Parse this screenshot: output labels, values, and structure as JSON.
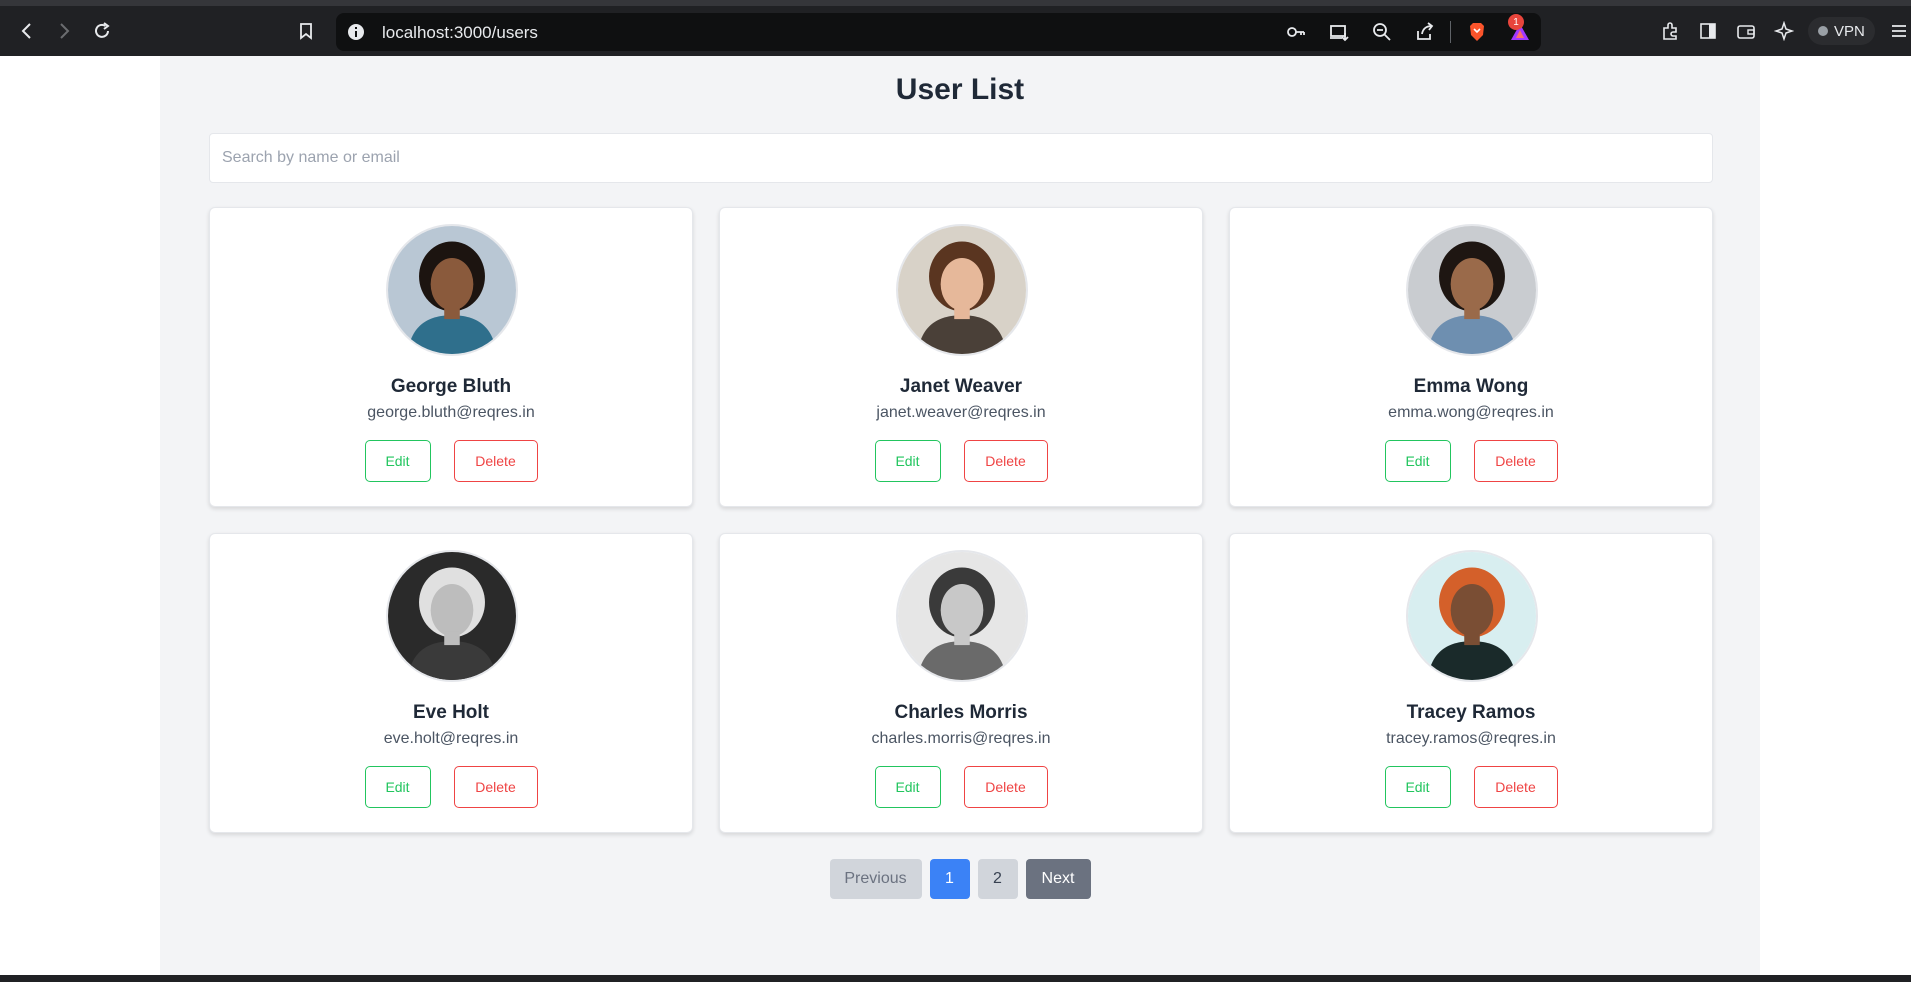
{
  "browser": {
    "url": "localhost:3000/users",
    "notification_count": "1",
    "vpn_label": "VPN",
    "icons": [
      "back-icon",
      "forward-icon",
      "reload-icon",
      "bookmark-icon",
      "info-icon",
      "key-icon",
      "install-icon",
      "zoom-out-icon",
      "share-icon",
      "brave-shield-icon",
      "rewards-icon",
      "extensions-icon",
      "sidebar-icon",
      "wallet-icon",
      "leo-icon",
      "menu-icon"
    ]
  },
  "page": {
    "title": "User List",
    "search_placeholder": "Search by name or email"
  },
  "users": [
    {
      "name": "George Bluth",
      "email": "george.bluth@reqres.in",
      "edit": "Edit",
      "delete": "Delete",
      "skin": "#8a5a3c",
      "hair": "#1c1410",
      "bg": "#b9c7d4",
      "shirt": "#2f6f8c"
    },
    {
      "name": "Janet Weaver",
      "email": "janet.weaver@reqres.in",
      "edit": "Edit",
      "delete": "Delete",
      "skin": "#e6b89a",
      "hair": "#5a3520",
      "bg": "#d8d2c8",
      "shirt": "#4a4038"
    },
    {
      "name": "Emma Wong",
      "email": "emma.wong@reqres.in",
      "edit": "Edit",
      "delete": "Delete",
      "skin": "#9a6a4a",
      "hair": "#1e1612",
      "bg": "#c9ccd0",
      "shirt": "#6e8fb0"
    },
    {
      "name": "Eve Holt",
      "email": "eve.holt@reqres.in",
      "edit": "Edit",
      "delete": "Delete",
      "skin": "#bdbdbd",
      "hair": "#e0e0e0",
      "bg": "#2a2a2a",
      "shirt": "#3a3a3a"
    },
    {
      "name": "Charles Morris",
      "email": "charles.morris@reqres.in",
      "edit": "Edit",
      "delete": "Delete",
      "skin": "#c8c8c8",
      "hair": "#3a3a3a",
      "bg": "#e6e6e6",
      "shirt": "#6a6a6a"
    },
    {
      "name": "Tracey Ramos",
      "email": "tracey.ramos@reqres.in",
      "edit": "Edit",
      "delete": "Delete",
      "skin": "#7a4e34",
      "hair": "#d4602a",
      "bg": "#d8eef0",
      "shirt": "#1a2a2a"
    }
  ],
  "pagination": {
    "previous": "Previous",
    "page1": "1",
    "page2": "2",
    "next": "Next",
    "current_page": "1"
  },
  "colors": {
    "accent": "#3b82f6",
    "edit": "#22c55e",
    "delete": "#ef4444",
    "page_bg": "#f3f4f6"
  }
}
